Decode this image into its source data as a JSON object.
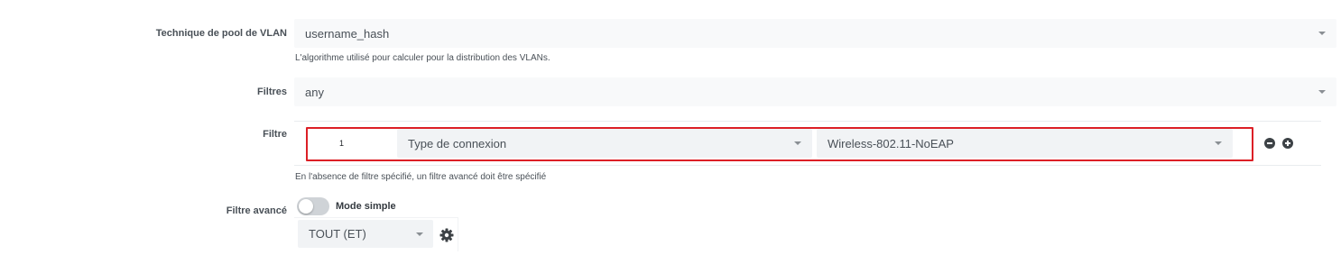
{
  "vlan_pool": {
    "label": "Technique de pool de VLAN",
    "value": "username_hash",
    "help": "L'algorithme utilisé pour calculer pour la distribution des VLANs."
  },
  "filters": {
    "label": "Filtres",
    "value": "any"
  },
  "filter": {
    "label": "Filtre",
    "row": {
      "index": "1",
      "type": "Type de connexion",
      "value": "Wireless-802.11-NoEAP"
    },
    "help": "En l'absence de filtre spécifié, un filtre avancé doit être spécifié",
    "highlight_color": "#dc1f26"
  },
  "advanced_filter": {
    "label": "Filtre avancé",
    "mode_label": "Mode simple",
    "toggle_on": false,
    "operator": "TOUT (ET)"
  },
  "icons": {
    "caret": "chevron-down-icon",
    "remove": "minus-circle-icon",
    "add": "plus-circle-icon",
    "settings": "gear-icon"
  }
}
